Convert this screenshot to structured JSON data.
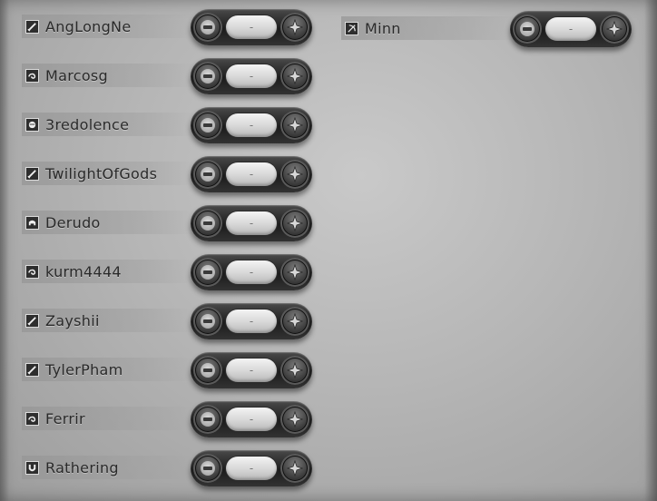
{
  "players_left": [
    {
      "name": "AngLongNe",
      "mode_icon": "sword-icon",
      "level": "-"
    },
    {
      "name": "Marcosg",
      "mode_icon": "swirl-icon",
      "level": "-"
    },
    {
      "name": "3redolence",
      "mode_icon": "fist-icon",
      "level": "-"
    },
    {
      "name": "TwilightOfGods",
      "mode_icon": "sword-icon",
      "level": "-"
    },
    {
      "name": "Derudo",
      "mode_icon": "helmet-icon",
      "level": "-"
    },
    {
      "name": "kurm4444",
      "mode_icon": "swirl-icon",
      "level": "-"
    },
    {
      "name": "Zayshii",
      "mode_icon": "sword-icon",
      "level": "-"
    },
    {
      "name": "TylerPham",
      "mode_icon": "sword-icon",
      "level": "-"
    },
    {
      "name": "Ferrir",
      "mode_icon": "swirl-icon",
      "level": "-"
    },
    {
      "name": "Rathering",
      "mode_icon": "horseshoe-icon",
      "level": "-"
    }
  ],
  "players_right": [
    {
      "name": "Minn",
      "mode_icon": "bow-icon",
      "level": "-"
    }
  ],
  "colors": {
    "panel": "#b6b6b6",
    "name_text": "#2a2a2a",
    "control_dark": "#1c1c1c",
    "pill_light": "#e6e6e6"
  }
}
